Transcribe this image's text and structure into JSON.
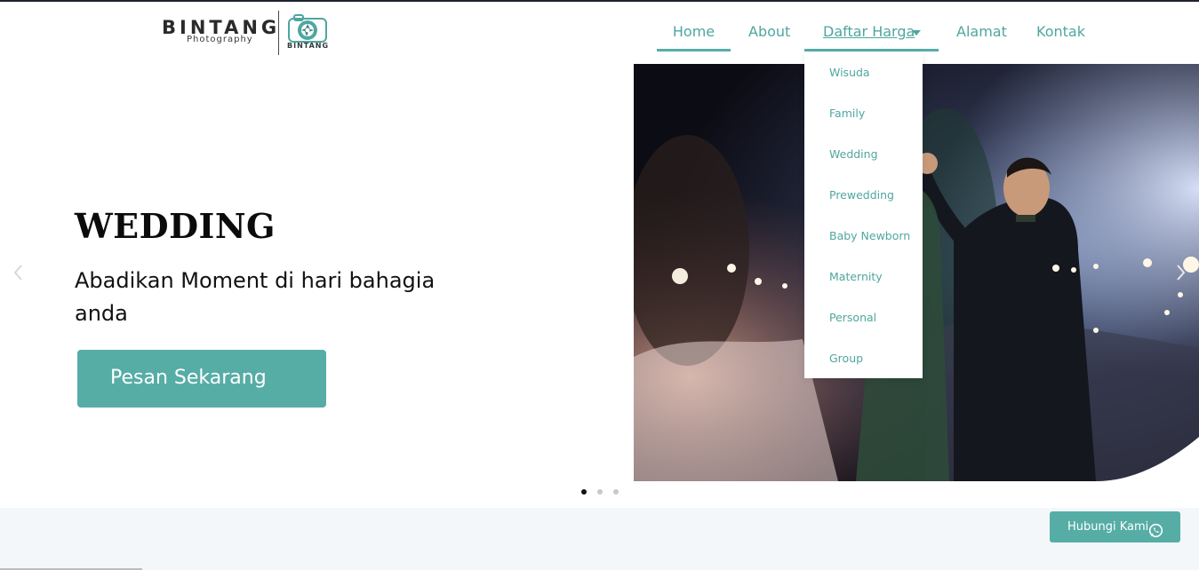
{
  "brand": {
    "name": "BINTANG",
    "tagline": "Photography",
    "mark_text": "BINTANG"
  },
  "nav": {
    "items": [
      {
        "label": "Home"
      },
      {
        "label": "About"
      },
      {
        "label": "Daftar Harga"
      },
      {
        "label": "Alamat"
      },
      {
        "label": "Kontak"
      }
    ],
    "active": [
      "Home",
      "Daftar Harga"
    ]
  },
  "dropdown": {
    "items": [
      "Wisuda",
      "Family",
      "Wedding",
      "Prewedding",
      "Baby Newborn",
      "Maternity",
      "Personal",
      "Group"
    ]
  },
  "hero": {
    "title": "WEDDING",
    "subtitle": "Abadikan Moment di hari bahagia anda",
    "cta": "Pesan Sekarang"
  },
  "carousel": {
    "slides": 3,
    "current": 1
  },
  "contact_button": {
    "label": "Hubungi Kami",
    "icon": "whatsapp-icon"
  },
  "colors": {
    "accent": "#56ada6",
    "nav_text": "#4fa6a0",
    "footer_band": "#f3f7fa"
  }
}
